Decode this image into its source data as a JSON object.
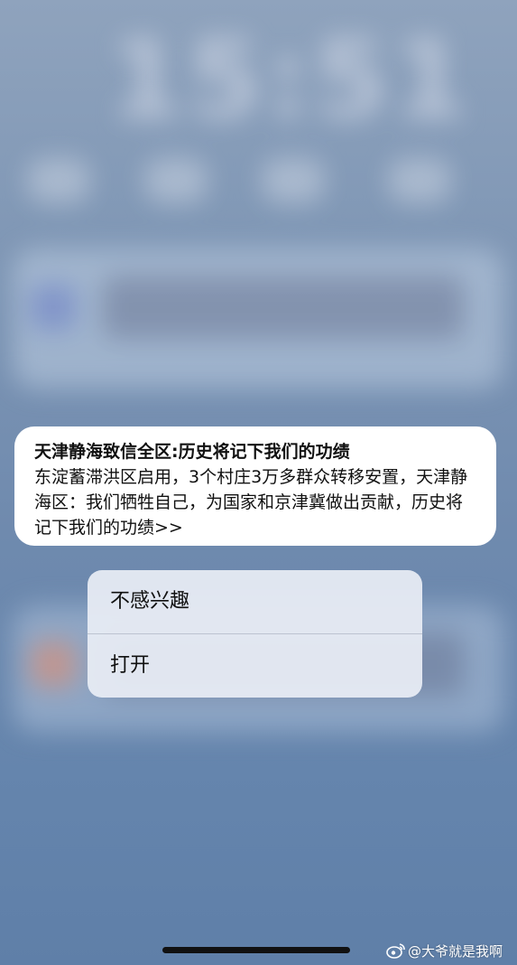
{
  "lock_screen": {
    "clock_text": "15:51"
  },
  "notification": {
    "title": "天津静海致信全区:历史将记下我们的功绩",
    "body": "东淀蓄滞洪区启用，3个村庄3万多群众转移安置，天津静海区：我们牺牲自己，为国家和京津冀做出贡献，历史将记下我们的功绩>>"
  },
  "context_menu": {
    "items": [
      {
        "label": "不感兴趣"
      },
      {
        "label": "打开"
      }
    ]
  },
  "watermark": {
    "text": "@大爷就是我啊",
    "icon": "weibo-icon"
  },
  "colors": {
    "background_top": "#8fa3bd",
    "background_bottom": "#5f7fa8",
    "notification_bg": "#ffffff",
    "menu_bg": "#e8ecf4",
    "text": "#111111"
  }
}
